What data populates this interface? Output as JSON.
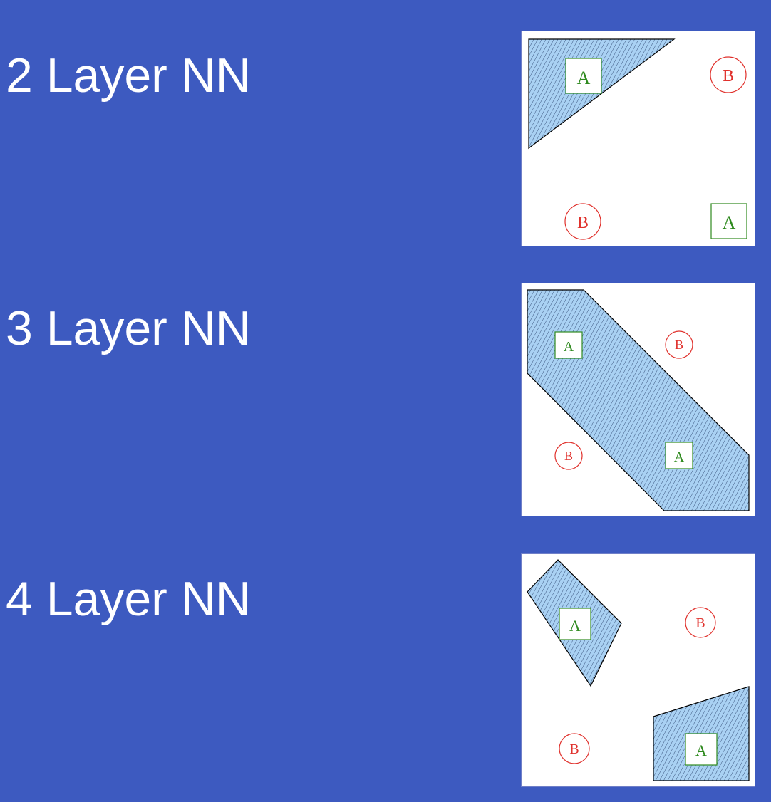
{
  "rows": [
    {
      "title": "2 Layer NN",
      "markers": [
        {
          "kind": "square",
          "letter": "A"
        },
        {
          "kind": "circle",
          "letter": "B"
        },
        {
          "kind": "circle",
          "letter": "B"
        },
        {
          "kind": "square",
          "letter": "A"
        }
      ]
    },
    {
      "title": "3 Layer NN",
      "markers": [
        {
          "kind": "square",
          "letter": "A"
        },
        {
          "kind": "circle",
          "letter": "B"
        },
        {
          "kind": "circle",
          "letter": "B"
        },
        {
          "kind": "square",
          "letter": "A"
        }
      ]
    },
    {
      "title": "4 Layer NN",
      "markers": [
        {
          "kind": "square",
          "letter": "A"
        },
        {
          "kind": "circle",
          "letter": "B"
        },
        {
          "kind": "circle",
          "letter": "B"
        },
        {
          "kind": "square",
          "letter": "A"
        }
      ]
    }
  ],
  "colors": {
    "background": "#3d5ac0",
    "region_fill": "#a9d1f3",
    "class_a": "#2f8a1f",
    "class_b": "#e0312c"
  }
}
